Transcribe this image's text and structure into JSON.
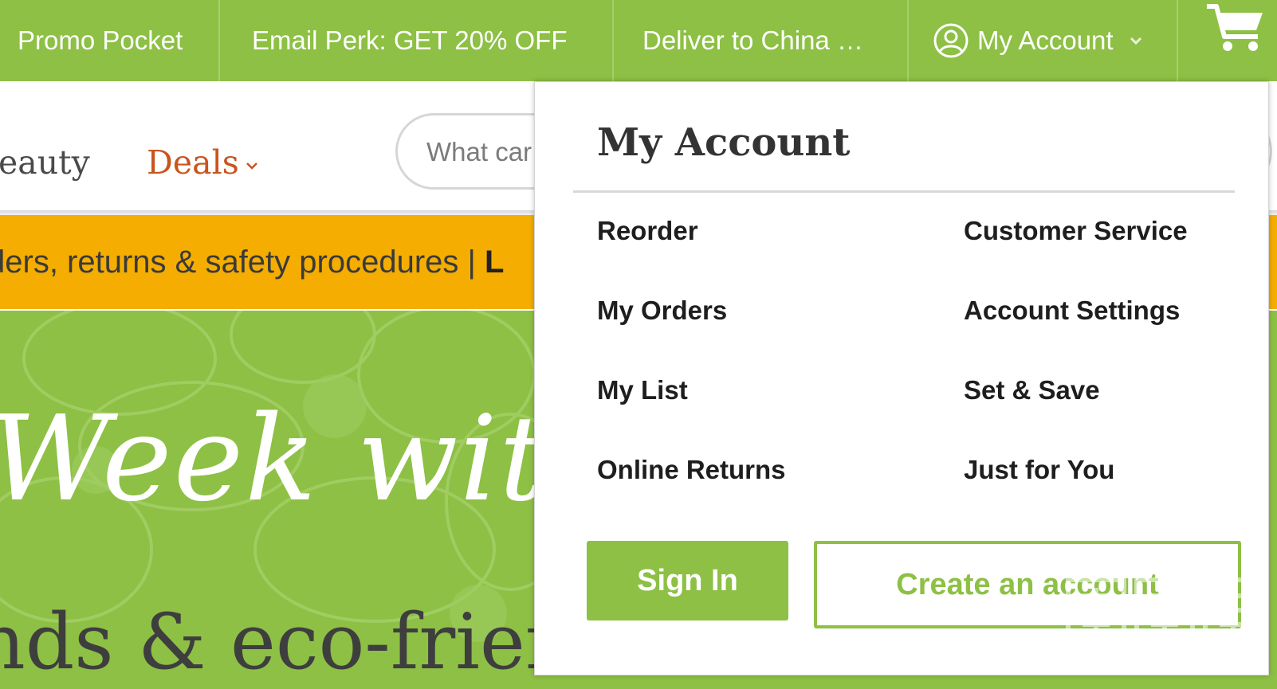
{
  "topbar": {
    "promo": "Promo Pocket",
    "email_perk": "Email Perk: GET 20% OFF",
    "deliver": "Deliver to China …",
    "account": "My Account",
    "icons": {
      "account": "user-circle-icon",
      "chevron": "chevron-down-icon",
      "cart": "shopping-cart-icon"
    },
    "bg_color": "#8dc044"
  },
  "nav": {
    "beauty": "eauty",
    "deals": "Deals"
  },
  "search": {
    "placeholder": "What car"
  },
  "notice": {
    "text": "ders, returns & safety procedures | ",
    "bold": "L"
  },
  "hero": {
    "title": "Week with V",
    "subtitle": "nds & eco-frien"
  },
  "dropdown": {
    "title": "My Account",
    "links_left": [
      "Reorder",
      "My Orders",
      "My List",
      "Online Returns"
    ],
    "links_right": [
      "Customer Service",
      "Account Settings",
      "Set & Save",
      "Just for You"
    ],
    "sign_in": "Sign In",
    "create_account": "Create an account",
    "accent_color": "#8dc044"
  },
  "watermark": {
    "text": "zhizhizhi.com"
  }
}
